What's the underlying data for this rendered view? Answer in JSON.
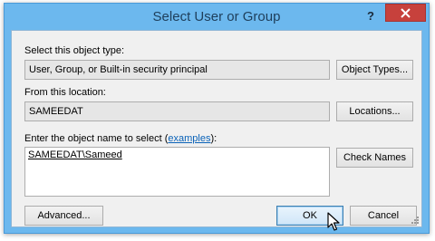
{
  "window": {
    "title": "Select User or Group",
    "help_label": "?"
  },
  "object_type": {
    "label": "Select this object type:",
    "value": "User, Group, or Built-in security principal",
    "button": "Object Types..."
  },
  "location": {
    "label": "From this location:",
    "value": "SAMEEDAT",
    "button": "Locations..."
  },
  "object_name": {
    "label_prefix": "Enter the object name to select (",
    "label_link": "examples",
    "label_suffix": "):",
    "value": "SAMEEDAT\\Sameed",
    "button": "Check Names"
  },
  "footer": {
    "advanced": "Advanced...",
    "ok": "OK",
    "cancel": "Cancel"
  },
  "colors": {
    "frame": "#6cb8ee",
    "close": "#c7413c",
    "link": "#0a62b8"
  }
}
